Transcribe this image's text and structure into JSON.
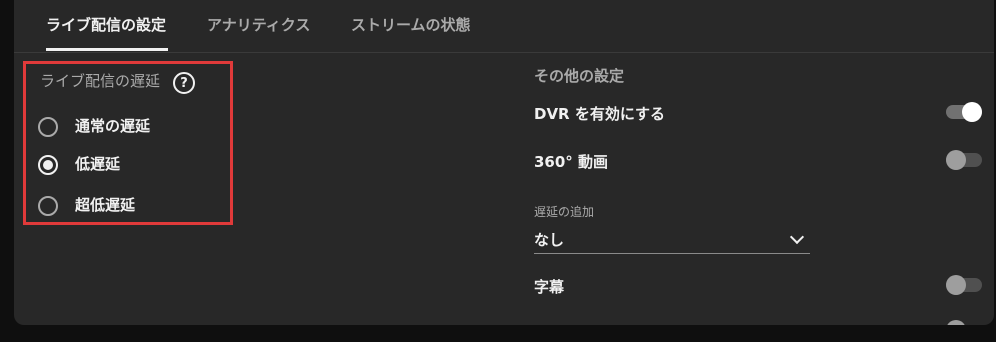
{
  "tabs": [
    {
      "label": "ライブ配信の設定",
      "active": true
    },
    {
      "label": "アナリティクス",
      "active": false
    },
    {
      "label": "ストリームの状態",
      "active": false
    }
  ],
  "latency": {
    "label": "ライブ配信の遅延",
    "help_icon": "?",
    "options": [
      {
        "label": "通常の遅延",
        "selected": false
      },
      {
        "label": "低遅延",
        "selected": true
      },
      {
        "label": "超低遅延",
        "selected": false
      }
    ]
  },
  "other_settings": {
    "heading": "その他の設定",
    "dvr": {
      "label": "DVR を有効にする",
      "enabled": true
    },
    "video360": {
      "label": "360° 動画",
      "enabled": false
    },
    "delay": {
      "label": "遅延の追加",
      "value": "なし"
    },
    "captions": {
      "label": "字幕",
      "enabled": false
    }
  },
  "colors": {
    "highlight": "#e03a3a",
    "panel_bg": "#282828",
    "page_bg": "#0f0f0f"
  }
}
